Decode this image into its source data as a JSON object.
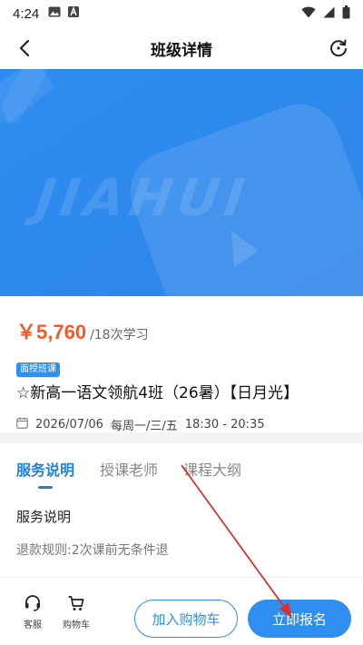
{
  "status_bar": {
    "time": "4:24",
    "icons": [
      "image-icon",
      "a-icon",
      "wifi-icon",
      "signal-icon",
      "battery-icon"
    ]
  },
  "header": {
    "title": "班级详情",
    "back_icon": "chevron-left-icon",
    "refresh_icon": "refresh-icon"
  },
  "banner": {
    "watermark": "JIAHUI",
    "color": "#2f8ff0"
  },
  "course": {
    "price": "￥5,760",
    "students": "/18次学习",
    "badge": "面授班课",
    "title": "☆新高一语文领航4班（26暑）【日月光】",
    "date": "2026/07/06",
    "weekdays": "每周一/三/五",
    "time": "18:30 - 20:35"
  },
  "tabs": [
    {
      "label": "服务说明",
      "active": true
    },
    {
      "label": "授课老师",
      "active": false
    },
    {
      "label": "课程大纲",
      "active": false
    }
  ],
  "service": {
    "title": "服务说明",
    "rule": "退款规则:2次课前无条件退"
  },
  "bottom_bar": {
    "service_label": "客服",
    "cart_label": "购物车",
    "add_cart_button": "加入购物车",
    "enroll_button": "立即报名"
  },
  "colors": {
    "accent": "#2f8ff0",
    "price": "#f25a29",
    "annotation_arrow": "#d93030"
  }
}
